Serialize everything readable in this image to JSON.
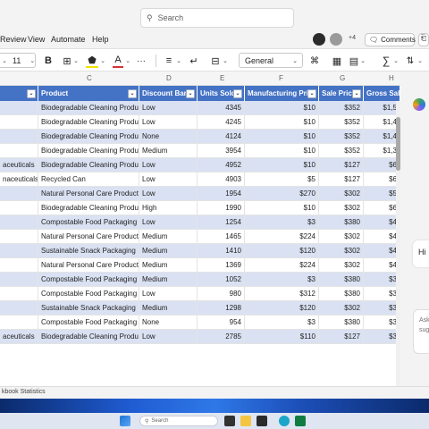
{
  "search": {
    "label": "Search"
  },
  "menu": {
    "items": [
      "Review",
      "View",
      "Automate",
      "Help"
    ]
  },
  "header": {
    "collab_count": "+4",
    "comments_label": "Comments"
  },
  "toolbar": {
    "font_size": "11",
    "bold": "B",
    "font_color": "A",
    "number_format": "General",
    "more": "···"
  },
  "grid": {
    "column_letters": [
      "C",
      "D",
      "E",
      "F",
      "G",
      "H"
    ],
    "headers": [
      "Product",
      "Discount Band",
      "Units Sold",
      "Manufacturing Price",
      "Sale Price",
      "Gross Sales"
    ],
    "rows": [
      {
        "seg": "",
        "product": "Biodegradable Cleaning Products",
        "band": "Low",
        "units": "4345",
        "mfg": "$10",
        "sale": "$352",
        "gross": "$1,5"
      },
      {
        "seg": "",
        "product": "Biodegradable Cleaning Products",
        "band": "Low",
        "units": "4245",
        "mfg": "$10",
        "sale": "$352",
        "gross": "$1,4"
      },
      {
        "seg": "",
        "product": "Biodegradable Cleaning Products",
        "band": "None",
        "units": "4124",
        "mfg": "$10",
        "sale": "$352",
        "gross": "$1,4"
      },
      {
        "seg": "",
        "product": "Biodegradable Cleaning Products",
        "band": "Medium",
        "units": "3954",
        "mfg": "$10",
        "sale": "$352",
        "gross": "$1,3"
      },
      {
        "seg": "aceuticals",
        "product": "Biodegradable Cleaning Products",
        "band": "Low",
        "units": "4952",
        "mfg": "$10",
        "sale": "$127",
        "gross": "$6"
      },
      {
        "seg": "naceuticals",
        "product": "Recycled Can",
        "band": "Low",
        "units": "4903",
        "mfg": "$5",
        "sale": "$127",
        "gross": "$6"
      },
      {
        "seg": "",
        "product": "Natural Personal Care Products",
        "band": "Low",
        "units": "1954",
        "mfg": "$270",
        "sale": "$302",
        "gross": "$5"
      },
      {
        "seg": "",
        "product": "Biodegradable Cleaning Products",
        "band": "High",
        "units": "1990",
        "mfg": "$10",
        "sale": "$302",
        "gross": "$6"
      },
      {
        "seg": "",
        "product": "Compostable Food Packaging",
        "band": "Low",
        "units": "1254",
        "mfg": "$3",
        "sale": "$380",
        "gross": "$4"
      },
      {
        "seg": "",
        "product": "Natural Personal Care Products",
        "band": "Medium",
        "units": "1465",
        "mfg": "$224",
        "sale": "$302",
        "gross": "$4"
      },
      {
        "seg": "",
        "product": "Sustainable Snack Packaging",
        "band": "Medium",
        "units": "1410",
        "mfg": "$120",
        "sale": "$302",
        "gross": "$4"
      },
      {
        "seg": "",
        "product": "Natural Personal Care Products",
        "band": "Medium",
        "units": "1369",
        "mfg": "$224",
        "sale": "$302",
        "gross": "$4"
      },
      {
        "seg": "",
        "product": "Compostable Food Packaging",
        "band": "Medium",
        "units": "1052",
        "mfg": "$3",
        "sale": "$380",
        "gross": "$3"
      },
      {
        "seg": "",
        "product": "Compostable Food Packaging",
        "band": "Low",
        "units": "980",
        "mfg": "$312",
        "sale": "$380",
        "gross": "$3"
      },
      {
        "seg": "",
        "product": "Sustainable Snack Packaging",
        "band": "Medium",
        "units": "1298",
        "mfg": "$120",
        "sale": "$302",
        "gross": "$3"
      },
      {
        "seg": "",
        "product": "Compostable Food Packaging",
        "band": "None",
        "units": "954",
        "mfg": "$3",
        "sale": "$380",
        "gross": "$3"
      },
      {
        "seg": "aceuticals",
        "product": "Biodegradable Cleaning Products",
        "band": "Low",
        "units": "2785",
        "mfg": "$110",
        "sale": "$127",
        "gross": "$3"
      }
    ]
  },
  "side": {
    "greeting": "Hi",
    "ask_text": "Ask sug"
  },
  "sheet": {
    "tab_label": "kbook Statistics"
  },
  "taskbar": {
    "search_label": "Search"
  },
  "colors": {
    "header_bg": "#4472c4",
    "band_bg": "#d9e1f2"
  }
}
